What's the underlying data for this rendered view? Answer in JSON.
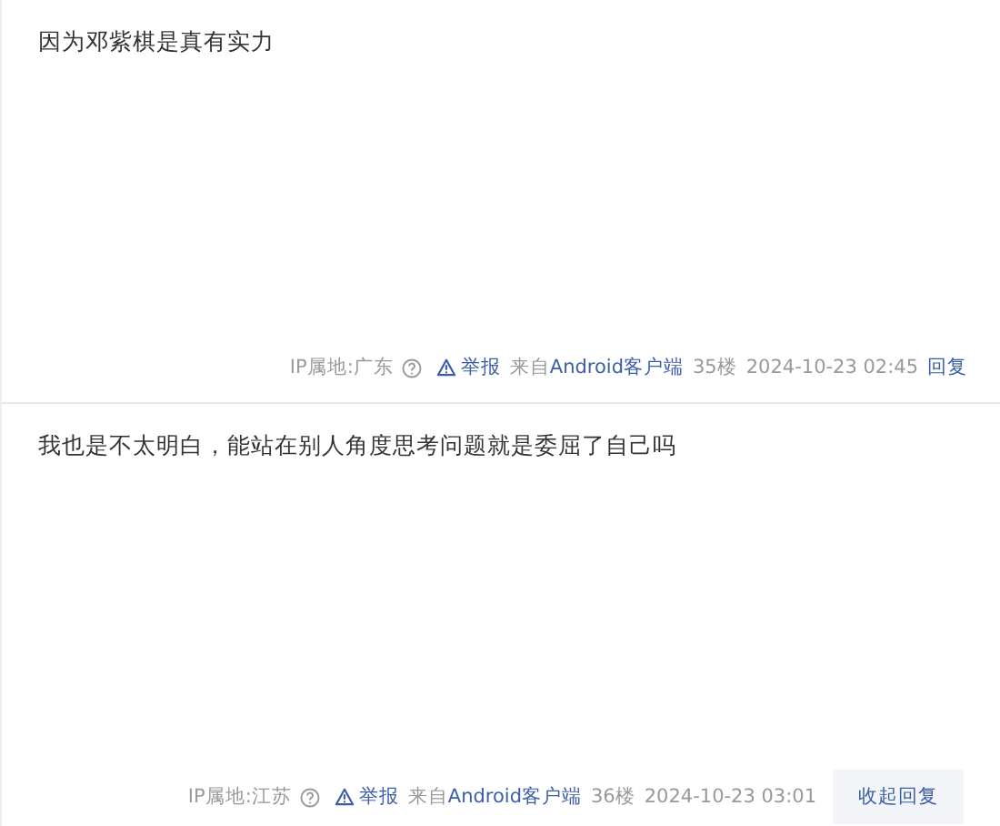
{
  "posts": [
    {
      "content": "因为邓紫棋是真有实力",
      "ip_location": "IP属地:广东",
      "report": "举报",
      "source": "来自Android客户端",
      "floor": "35楼",
      "time": "2024-10-23 02:45",
      "reply_label": "回复",
      "replies_expanded": false
    },
    {
      "content": "我也是不太明白，能站在别人角度思考问题就是委屈了自己吗",
      "ip_location": "IP属地:江苏",
      "report": "举报",
      "source": "来自Android客户端",
      "floor": "36楼",
      "time": "2024-10-23 03:01",
      "reply_label": "收起回复",
      "replies_expanded": true
    }
  ]
}
